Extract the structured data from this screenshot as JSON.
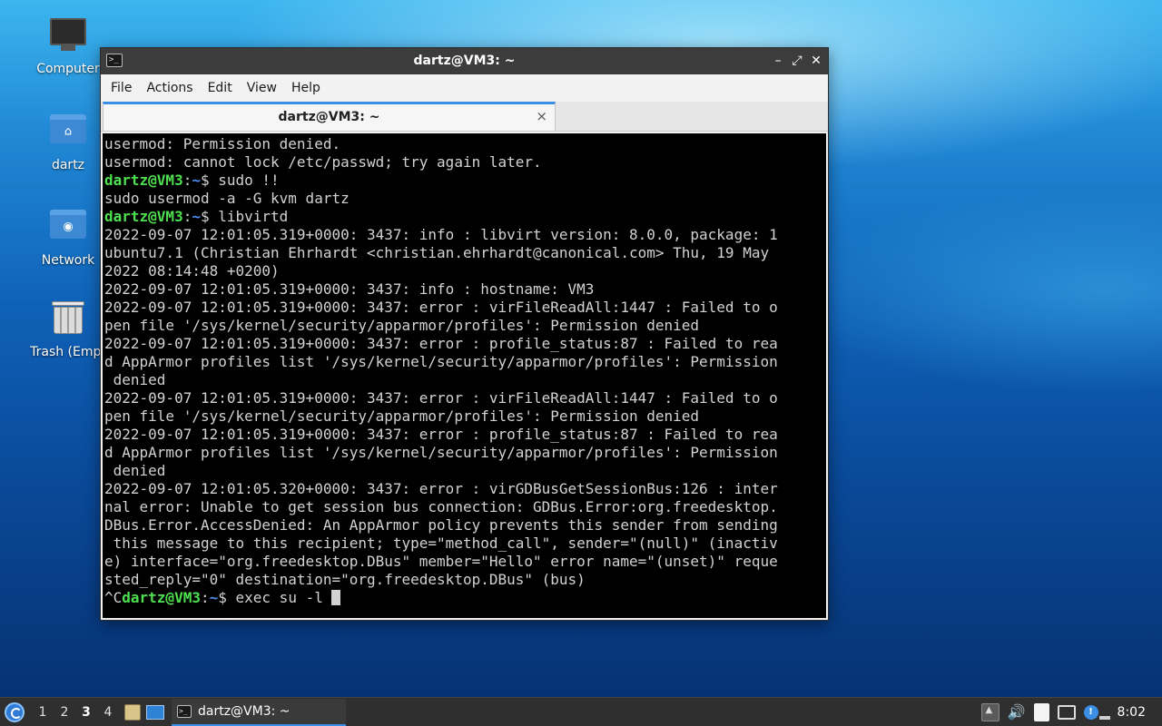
{
  "desktop": {
    "icons": [
      {
        "label": "Computer",
        "icon": "computer-icon"
      },
      {
        "label": "dartz",
        "icon": "home-folder-icon"
      },
      {
        "label": "Network",
        "icon": "network-folder-icon"
      },
      {
        "label": "Trash (Empt",
        "icon": "trash-icon"
      }
    ]
  },
  "window": {
    "title": "dartz@VM3: ~",
    "controls": {
      "minimize": "–",
      "maximize": "⤢",
      "close": "✕"
    },
    "menu": [
      "File",
      "Actions",
      "Edit",
      "View",
      "Help"
    ],
    "tab": {
      "label": "dartz@VM3: ~",
      "close": "×"
    }
  },
  "terminal": {
    "prompt_user": "dartz@VM3",
    "prompt_path": "~",
    "lines": [
      "usermod: Permission denied.",
      "usermod: cannot lock /etc/passwd; try again later.",
      "sudo !!",
      "sudo usermod -a -G kvm dartz",
      "libvirtd",
      "2022-09-07 12:01:05.319+0000: 3437: info : libvirt version: 8.0.0, package: 1",
      "ubuntu7.1 (Christian Ehrhardt <christian.ehrhardt@canonical.com> Thu, 19 May",
      "2022 08:14:48 +0200)",
      "2022-09-07 12:01:05.319+0000: 3437: info : hostname: VM3",
      "2022-09-07 12:01:05.319+0000: 3437: error : virFileReadAll:1447 : Failed to o",
      "pen file '/sys/kernel/security/apparmor/profiles': Permission denied",
      "2022-09-07 12:01:05.319+0000: 3437: error : profile_status:87 : Failed to rea",
      "d AppArmor profiles list '/sys/kernel/security/apparmor/profiles': Permission",
      " denied",
      "2022-09-07 12:01:05.319+0000: 3437: error : virFileReadAll:1447 : Failed to o",
      "pen file '/sys/kernel/security/apparmor/profiles': Permission denied",
      "2022-09-07 12:01:05.319+0000: 3437: error : profile_status:87 : Failed to rea",
      "d AppArmor profiles list '/sys/kernel/security/apparmor/profiles': Permission",
      " denied",
      "2022-09-07 12:01:05.320+0000: 3437: error : virGDBusGetSessionBus:126 : inter",
      "nal error: Unable to get session bus connection: GDBus.Error:org.freedesktop.",
      "DBus.Error.AccessDenied: An AppArmor policy prevents this sender from sending",
      " this message to this recipient; type=\"method_call\", sender=\"(null)\" (inactiv",
      "e) interface=\"org.freedesktop.DBus\" member=\"Hello\" error name=\"(unset)\" reque",
      "sted_reply=\"0\" destination=\"org.freedesktop.DBus\" (bus)",
      "^C",
      "exec su -l "
    ]
  },
  "taskbar": {
    "workspaces": [
      "1",
      "2",
      "3",
      "4"
    ],
    "active_workspace": "3",
    "task_label": "dartz@VM3: ~",
    "tray_update_badge": "!",
    "clock": "8:02"
  }
}
